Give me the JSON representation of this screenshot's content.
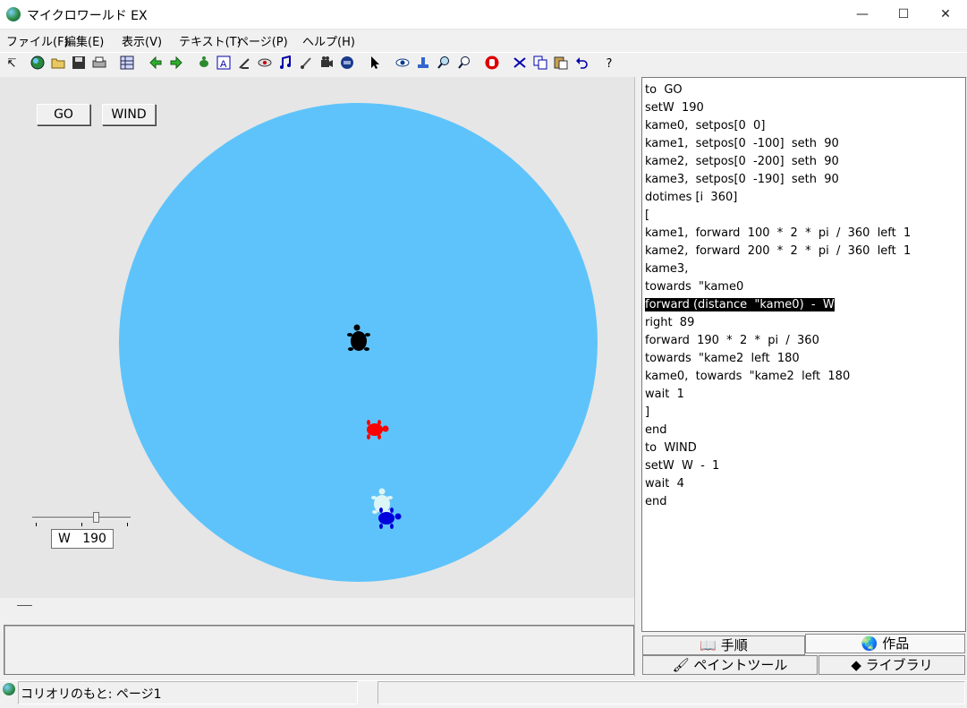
{
  "window": {
    "title": "マイクロワールド EX",
    "minimize": "—",
    "maximize": "☐",
    "close": "✕"
  },
  "menu": [
    "ファイル(F)",
    "編集(E)",
    "表示(V)",
    "テキスト(T)",
    "ページ(P)",
    "ヘルプ(H)"
  ],
  "toolbar_icons": [
    "cursor-icon",
    "globe-icon",
    "open-folder-icon",
    "save-icon",
    "print-icon",
    "grid-icon",
    "back-arrow-icon",
    "forward-arrow-icon",
    "turtle-icon",
    "text-box-icon",
    "pen-icon",
    "eye-toggle-icon",
    "music-icon",
    "paint-icon",
    "film-icon",
    "helmet-icon",
    "pointer-icon",
    "eye-icon",
    "stamp-icon",
    "zoom-in-icon",
    "zoom-out-icon",
    "stop-hand-icon",
    "scissors-icon",
    "copy-icon",
    "paste-icon",
    "undo-icon",
    "help-icon"
  ],
  "stage": {
    "go_label": "GO",
    "wind_label": "WIND",
    "slider_label": "W",
    "slider_value": "190",
    "pond_color": "#5ec3fb",
    "background": "#e6e6e6"
  },
  "turtles": [
    {
      "name": "kame0",
      "color": "#000000"
    },
    {
      "name": "kame1",
      "color": "#ff0000"
    },
    {
      "name": "kame2",
      "color": "#0000dd"
    },
    {
      "name": "kame3",
      "color": "#dcf5f5"
    }
  ],
  "code_lines": [
    "to  GO",
    "setW  190",
    "kame0,  setpos[0  0]",
    "kame1,  setpos[0  -100]  seth  90",
    "kame2,  setpos[0  -200]  seth  90",
    "kame3,  setpos[0  -190]  seth  90",
    "dotimes [i  360]",
    "[",
    "kame1,  forward  100  *  2  *  pi  /  360  left  1",
    "kame2,  forward  200  *  2  *  pi  /  360  left  1",
    "kame3,",
    "towards  \"kame0",
    "forward (distance  \"kame0)  -  W",
    "right  89",
    "forward  190  *  2  *  pi  /  360",
    "towards  \"kame2  left  180",
    "kame0,  towards  \"kame2  left  180",
    "wait  1",
    "]",
    "end",
    "to  WIND",
    "setW  W  -  1",
    "wait  4",
    "end"
  ],
  "highlight_line": 12,
  "tabs": {
    "procedures": "手順",
    "works": "作品",
    "paint_tools": "ペイントツール",
    "library": "ライブラリ"
  },
  "status": {
    "text": "コリオリのもと: ページ1"
  }
}
